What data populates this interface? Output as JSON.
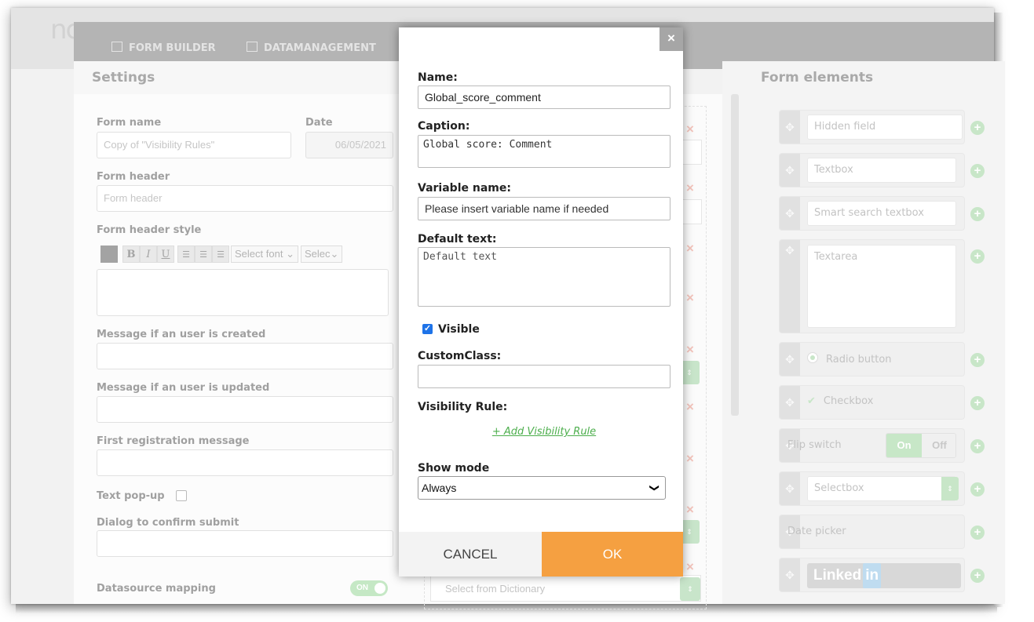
{
  "app": {
    "logo_text": "nc",
    "nav": [
      {
        "label": "FORM BUILDER",
        "icon": "form-icon"
      },
      {
        "label": "DATAMANAGEMENT",
        "icon": "database-icon"
      }
    ]
  },
  "settings": {
    "title": "Settings",
    "form_name_label": "Form name",
    "form_name_value": "Copy of \"Visibility Rules\"",
    "date_label": "Date",
    "date_value": "06/05/2021",
    "form_header_label": "Form header",
    "form_header_placeholder": "Form header",
    "form_header_style_label": "Form header style",
    "toolbar": {
      "bold": "B",
      "italic": "I",
      "underline": "U",
      "font_select": "Select font",
      "size_select": "Selec"
    },
    "msg_created_label": "Message if an user is created",
    "msg_updated_label": "Message if an user is updated",
    "first_reg_label": "First registration message",
    "text_popup_label": "Text pop-up",
    "confirm_submit_label": "Dialog to confirm submit",
    "datasource_label": "Datasource mapping",
    "datasource_toggle": "ON"
  },
  "middle": {
    "dictionary_placeholder": "Select from Dictionary"
  },
  "form_elements": {
    "title": "Form elements",
    "items": [
      {
        "label": "Hidden field",
        "icon": "move-icon"
      },
      {
        "label": "Textbox",
        "icon": "move-icon"
      },
      {
        "label": "Smart search textbox",
        "icon": "move-icon"
      },
      {
        "label": "Textarea",
        "icon": "move-icon"
      },
      {
        "label": "Radio button",
        "icon": "radio-icon"
      },
      {
        "label": "Checkbox",
        "icon": "check-icon"
      },
      {
        "label": "Flip switch",
        "on": "On",
        "off": "Off"
      },
      {
        "label": "Selectbox",
        "icon": "move-icon"
      },
      {
        "label": "Date picker",
        "icon": "move-icon"
      },
      {
        "label": "Linked",
        "badge": "in"
      }
    ]
  },
  "modal": {
    "close": "×",
    "name_label": "Name:",
    "name_value": "Global_score_comment",
    "caption_label": "Caption:",
    "caption_value": "Global score: Comment",
    "variable_label": "Variable name:",
    "variable_placeholder": "Please insert variable name if needed",
    "default_label": "Default text:",
    "default_placeholder": "Default text",
    "visible_label": "Visible",
    "visible_checked": true,
    "customclass_label": "CustomClass:",
    "customclass_value": "",
    "visibility_rule_label": "Visibility Rule:",
    "add_rule_link": "+ Add Visibility Rule",
    "show_mode_label": "Show mode",
    "show_mode_value": "Always",
    "cancel_label": "CANCEL",
    "ok_label": "OK"
  },
  "colors": {
    "accent_ok": "#f5a041",
    "link_green": "#4cae4c",
    "checkbox_blue": "#1e73e8"
  }
}
